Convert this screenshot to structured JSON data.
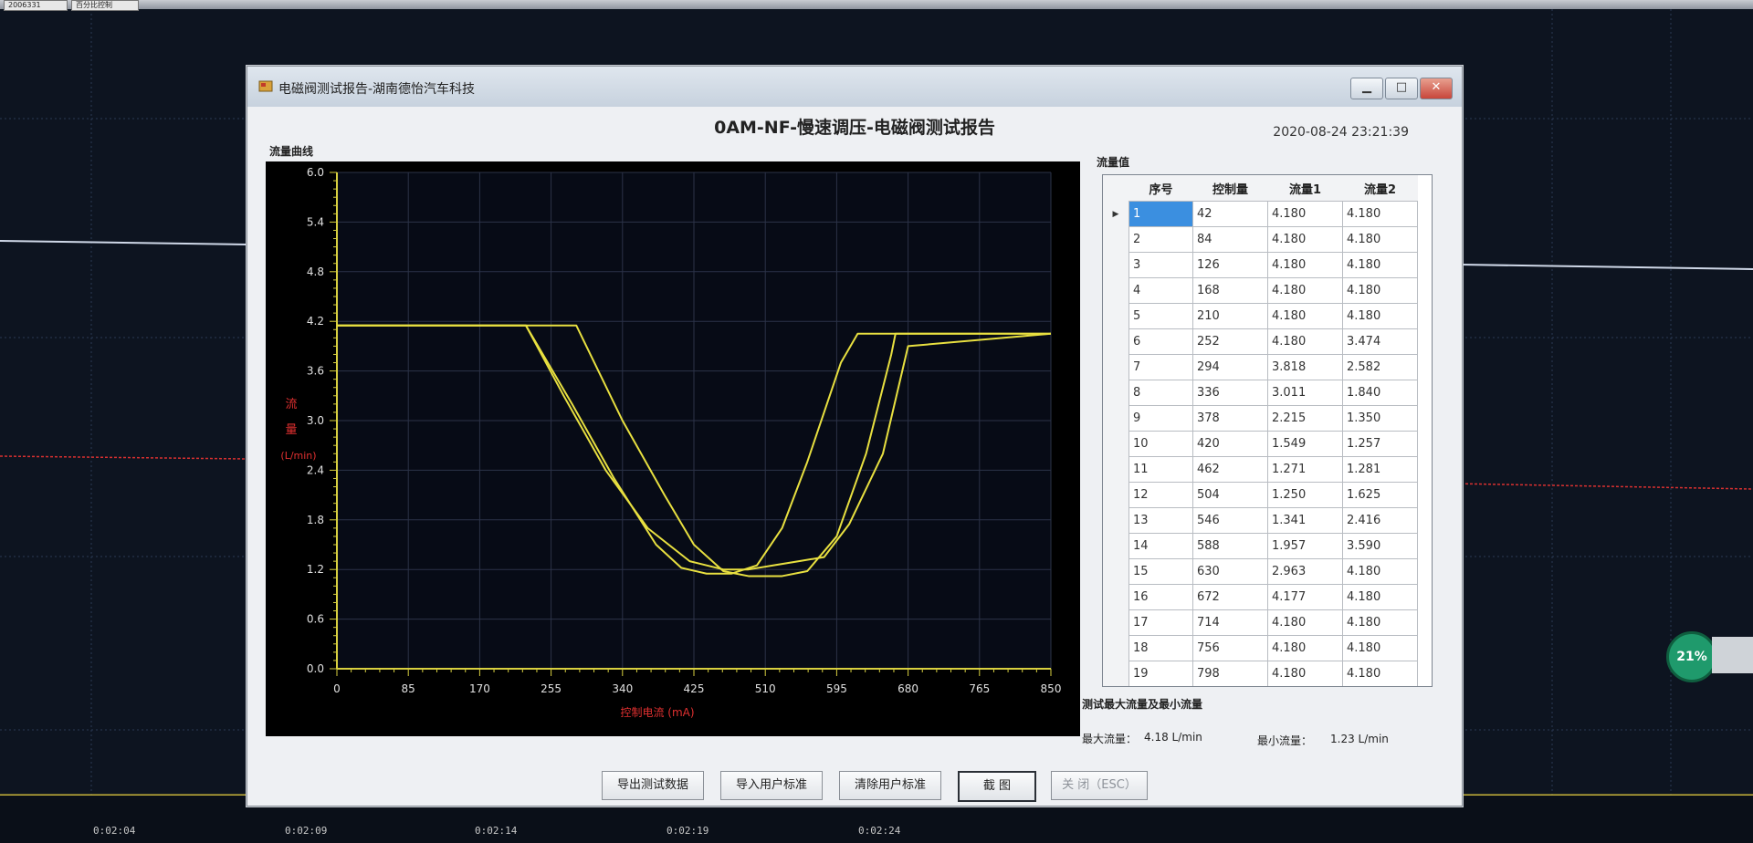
{
  "background_app": {
    "top_fields": [
      "2006331",
      "百分比控制"
    ],
    "timeline_labels": [
      "0:02:04",
      "0:02:09",
      "0:02:14",
      "0:02:19",
      "0:02:24"
    ],
    "progress_badge": "21%"
  },
  "dialog": {
    "window_title": "电磁阀测试报告-湖南德怡汽车科技",
    "report_title": "0AM-NF-慢速调压-电磁阀测试报告",
    "timestamp": "2020-08-24 23:21:39",
    "window_buttons": {
      "minimize": "▁",
      "maximize": "□",
      "close": "✕"
    },
    "chart_section_label": "流量曲线",
    "table_section_label": "流量值",
    "summary_section_label": "测试最大流量及最小流量",
    "max_flow_label": "最大流量：",
    "max_flow_value": "4.18 L/min",
    "min_flow_label": "最小流量：",
    "min_flow_value": "1.23 L/min",
    "buttons": {
      "export": "导出测试数据",
      "import_standard": "导入用户标准",
      "clear_standard": "清除用户标准",
      "screenshot": "截 图",
      "close": "关 闭（ESC）"
    }
  },
  "table": {
    "columns": [
      "序号",
      "控制量",
      "流量1",
      "流量2"
    ],
    "selected_row_marker": "▶",
    "rows": [
      [
        "1",
        "42",
        "4.180",
        "4.180"
      ],
      [
        "2",
        "84",
        "4.180",
        "4.180"
      ],
      [
        "3",
        "126",
        "4.180",
        "4.180"
      ],
      [
        "4",
        "168",
        "4.180",
        "4.180"
      ],
      [
        "5",
        "210",
        "4.180",
        "4.180"
      ],
      [
        "6",
        "252",
        "4.180",
        "3.474"
      ],
      [
        "7",
        "294",
        "3.818",
        "2.582"
      ],
      [
        "8",
        "336",
        "3.011",
        "1.840"
      ],
      [
        "9",
        "378",
        "2.215",
        "1.350"
      ],
      [
        "10",
        "420",
        "1.549",
        "1.257"
      ],
      [
        "11",
        "462",
        "1.271",
        "1.281"
      ],
      [
        "12",
        "504",
        "1.250",
        "1.625"
      ],
      [
        "13",
        "546",
        "1.341",
        "2.416"
      ],
      [
        "14",
        "588",
        "1.957",
        "3.590"
      ],
      [
        "15",
        "630",
        "2.963",
        "4.180"
      ],
      [
        "16",
        "672",
        "4.177",
        "4.180"
      ],
      [
        "17",
        "714",
        "4.180",
        "4.180"
      ],
      [
        "18",
        "756",
        "4.180",
        "4.180"
      ],
      [
        "19",
        "798",
        "4.180",
        "4.180"
      ]
    ]
  },
  "chart_data": {
    "type": "line",
    "title": "",
    "xlabel": "控制电流 (mA)",
    "ylabel": [
      "流",
      "量",
      "(L/min)"
    ],
    "xlim": [
      0,
      850
    ],
    "ylim": [
      0,
      6
    ],
    "x_ticks": [
      0,
      85,
      170,
      255,
      340,
      425,
      510,
      595,
      680,
      765,
      850
    ],
    "y_ticks": [
      0.0,
      0.6,
      1.2,
      1.8,
      2.4,
      3.0,
      3.6,
      4.2,
      4.8,
      5.4,
      6.0
    ],
    "grid": true,
    "line_color": "#e8e040",
    "axis_color": "#d8d040",
    "series": [
      {
        "x": [
          0,
          225,
          280,
          330,
          380,
          410,
          440,
          470,
          500,
          530,
          560,
          600,
          620,
          850
        ],
        "y": [
          4.15,
          4.15,
          3.2,
          2.3,
          1.5,
          1.22,
          1.15,
          1.15,
          1.25,
          1.7,
          2.5,
          3.7,
          4.05,
          4.05
        ]
      },
      {
        "x": [
          0,
          285,
          340,
          390,
          425,
          460,
          490,
          530,
          560,
          595,
          630,
          660,
          665,
          850
        ],
        "y": [
          4.15,
          4.15,
          3.0,
          2.1,
          1.5,
          1.18,
          1.12,
          1.12,
          1.18,
          1.6,
          2.6,
          3.8,
          4.05,
          4.05
        ]
      },
      {
        "x": [
          0,
          225,
          270,
          320,
          370,
          420,
          460,
          490,
          520,
          550,
          580,
          610,
          650,
          680,
          850
        ],
        "y": [
          4.15,
          4.15,
          3.3,
          2.4,
          1.7,
          1.3,
          1.2,
          1.2,
          1.25,
          1.3,
          1.35,
          1.75,
          2.6,
          3.9,
          4.05
        ]
      }
    ]
  }
}
